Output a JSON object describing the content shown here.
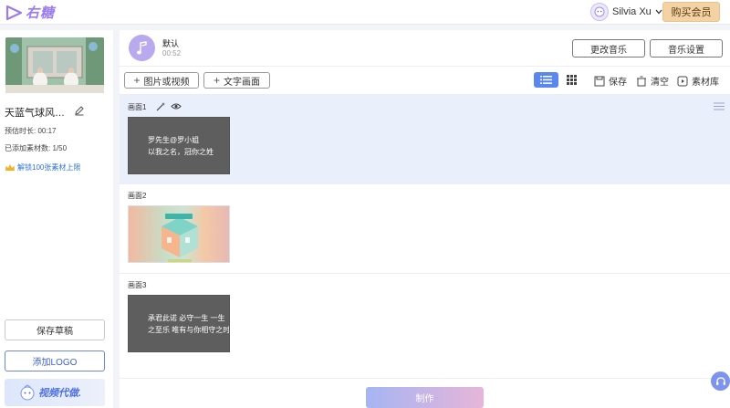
{
  "header": {
    "logo_text": "右糖",
    "user_name": "Silvia Xu",
    "buy_label": "购买会员"
  },
  "sidebar": {
    "project_title": "天蓝气球风…",
    "duration_label": "预估时长: 00:17",
    "materials_label": "已添加素材数: 1/50",
    "unlock_label": "解锁100张素材上限",
    "save_draft_label": "保存草稿",
    "add_logo_label": "添加LOGO",
    "promo_label": "视频代做."
  },
  "music": {
    "name": "默认",
    "duration": "00:52",
    "change_label": "更改音乐",
    "settings_label": "音乐设置"
  },
  "toolbar": {
    "add_media_label": "图片或视频",
    "add_text_label": "文字画面",
    "save_label": "保存",
    "clear_label": "清空",
    "library_label": "素材库"
  },
  "scenes": [
    {
      "label": "画面1",
      "lines": [
        "罗先生@罗小姐",
        "以我之名，冠你之姓"
      ]
    },
    {
      "label": "画面2"
    },
    {
      "label": "画面3",
      "lines": [
        "承君此诺 必守一生 一生",
        "之至乐 唯有与你相守之时"
      ]
    }
  ],
  "footer": {
    "make_label": "制作"
  },
  "colors": {
    "accent": "#5a86f0",
    "buy_bg": "#f3d3a4",
    "link": "#2f72d8"
  }
}
